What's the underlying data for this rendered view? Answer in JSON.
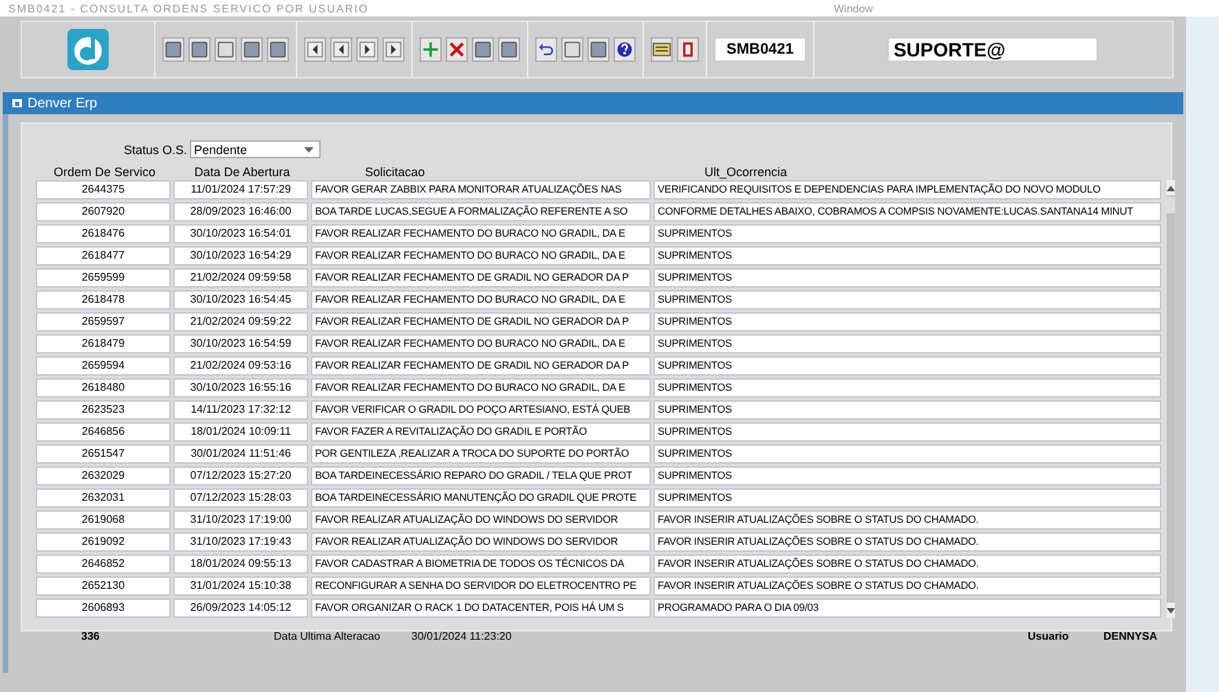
{
  "app_title": "SMB0421 - CONSULTA ORDENS SERVICO POR USUARIO",
  "menu": "Window",
  "toolbar": {
    "form_code": "SMB0421",
    "user_field": "SUPORTE@"
  },
  "window": {
    "title": "Denver Erp"
  },
  "filter": {
    "label": "Status O.S.",
    "value": "Pendente"
  },
  "table": {
    "columns": [
      "Ordem De Servico",
      "Data De Abertura",
      "Solicitacao",
      "Ult_Ocorrencia"
    ],
    "rows": [
      [
        "2644375",
        "11/01/2024 17:57:29",
        "FAVOR GERAR ZABBIX PARA MONITORAR ATUALIZAÇÕES NAS",
        "VERIFICANDO REQUISITOS E DEPENDENCIAS PARA IMPLEMENTAÇÃO DO NOVO MODULO"
      ],
      [
        "2607920",
        "28/09/2023 16:46:00",
        "BOA TARDE LUCAS,SEGUE A FORMALIZAÇÃO REFERENTE A SO",
        "CONFORME DETALHES ABAIXO, COBRAMOS A COMPSIS NOVAMENTE:LUCAS.SANTANA14 MINUT"
      ],
      [
        "2618476",
        "30/10/2023 16:54:01",
        "FAVOR REALIZAR FECHAMENTO DO BURACO NO GRADIL, DA E",
        "SUPRIMENTOS"
      ],
      [
        "2618477",
        "30/10/2023 16:54:29",
        "FAVOR REALIZAR FECHAMENTO DO BURACO NO GRADIL, DA E",
        "SUPRIMENTOS"
      ],
      [
        "2659599",
        "21/02/2024 09:59:58",
        "FAVOR REALIZAR FECHAMENTO DE GRADIL NO GERADOR DA P",
        "SUPRIMENTOS"
      ],
      [
        "2618478",
        "30/10/2023 16:54:45",
        "FAVOR REALIZAR FECHAMENTO DO BURACO NO GRADIL, DA E",
        "SUPRIMENTOS"
      ],
      [
        "2659597",
        "21/02/2024 09:59:22",
        "FAVOR REALIZAR FECHAMENTO DE GRADIL NO GERADOR DA P",
        "SUPRIMENTOS"
      ],
      [
        "2618479",
        "30/10/2023 16:54:59",
        "FAVOR REALIZAR FECHAMENTO DO BURACO NO GRADIL, DA E",
        "SUPRIMENTOS"
      ],
      [
        "2659594",
        "21/02/2024 09:53:16",
        "FAVOR REALIZAR FECHAMENTO DE GRADIL NO GERADOR DA P",
        "SUPRIMENTOS"
      ],
      [
        "2618480",
        "30/10/2023 16:55:16",
        "FAVOR REALIZAR FECHAMENTO DO BURACO NO GRADIL, DA E",
        "SUPRIMENTOS"
      ],
      [
        "2623523",
        "14/11/2023 17:32:12",
        "FAVOR VERIFICAR O GRADIL DO POÇO ARTESIANO, ESTÁ QUEB",
        "SUPRIMENTOS"
      ],
      [
        "2646856",
        "18/01/2024 10:09:11",
        "FAVOR FAZER A REVITALIZAÇÃO DO GRADIL E PORTÃO",
        "SUPRIMENTOS"
      ],
      [
        "2651547",
        "30/01/2024 11:51:46",
        "POR GENTILEZA ,REALIZAR A TROCA DO SUPORTE DO PORTÃO",
        "SUPRIMENTOS"
      ],
      [
        "2632029",
        "07/12/2023 15:27:20",
        "BOA TARDEINECESSÁRIO REPARO DO GRADIL / TELA QUE PROT",
        "SUPRIMENTOS"
      ],
      [
        "2632031",
        "07/12/2023 15:28:03",
        "BOA TARDEINECESSÁRIO MANUTENÇÃO DO GRADIL QUE PROTE",
        "SUPRIMENTOS"
      ],
      [
        "2619068",
        "31/10/2023 17:19:00",
        "FAVOR REALIZAR ATUALIZAÇÃO DO WINDOWS DO SERVIDOR",
        "FAVOR INSERIR ATUALIZAÇÕES SOBRE O STATUS DO CHAMADO."
      ],
      [
        "2619092",
        "31/10/2023 17:19:43",
        "FAVOR REALIZAR ATUALIZAÇÃO DO WINDOWS DO SERVIDOR",
        "FAVOR INSERIR ATUALIZAÇÕES SOBRE O STATUS DO CHAMADO."
      ],
      [
        "2646852",
        "18/01/2024 09:55:13",
        "FAVOR CADASTRAR A BIOMETRIA DE TODOS OS TÉCNICOS DA",
        "FAVOR INSERIR ATUALIZAÇÕES SOBRE O STATUS DO CHAMADO."
      ],
      [
        "2652130",
        "31/01/2024 15:10:38",
        "RECONFIGURAR A SENHA DO SERVIDOR DO ELETROCENTRO PE",
        "FAVOR INSERIR ATUALIZAÇÕES SOBRE O STATUS DO CHAMADO."
      ],
      [
        "2606893",
        "26/09/2023 14:05:12",
        "FAVOR ORGANIZAR O RACK 1 DO DATACENTER, POIS HÁ UM S",
        "PROGRAMADO PARA O DIA 09/03"
      ]
    ]
  },
  "footer": {
    "count": "336",
    "last_change_label": "Data Ultima Alteracao",
    "last_change_value": "30/01/2024 11:23:20",
    "user_label": "Usuario",
    "user_value": "DENNYSA"
  }
}
